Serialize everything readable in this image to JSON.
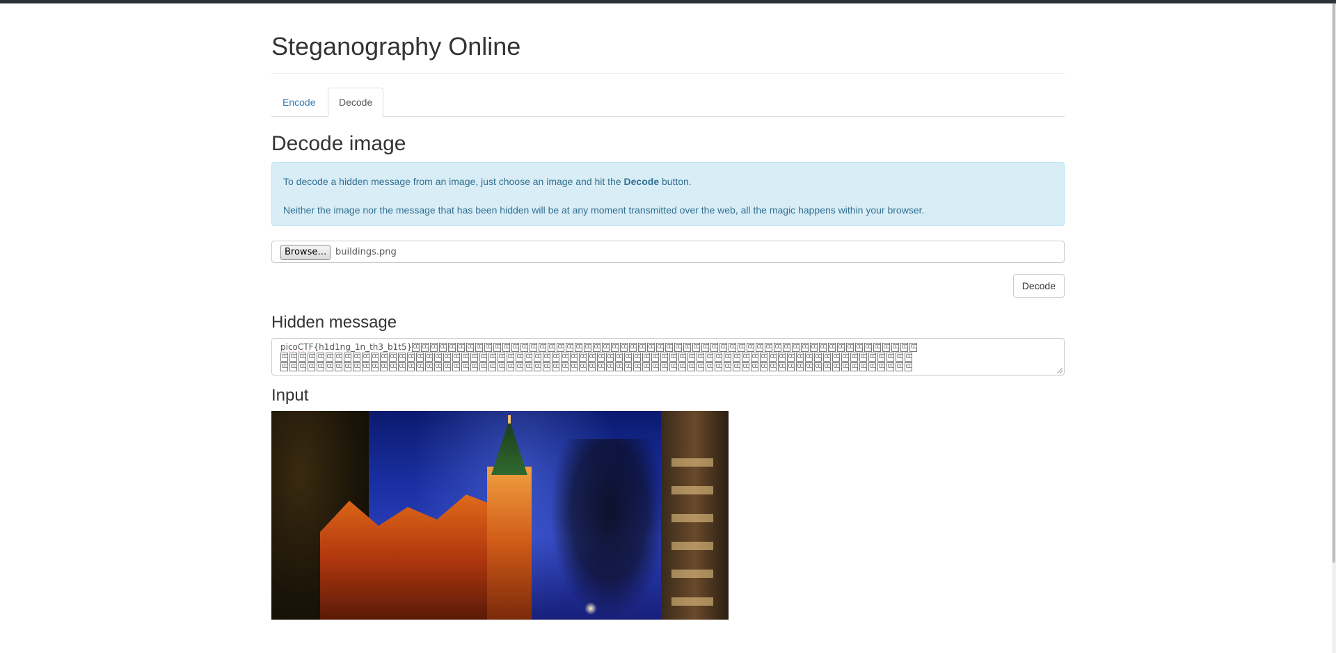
{
  "page": {
    "title": "Steganography Online"
  },
  "tabs": [
    {
      "label": "Encode",
      "active": false
    },
    {
      "label": "Decode",
      "active": true
    }
  ],
  "decode": {
    "title": "Decode image",
    "info_line1_prefix": "To decode a hidden message from an image, just choose an image and hit the ",
    "info_line1_bold": "Decode",
    "info_line1_suffix": " button.",
    "info_line2": "Neither the image nor the message that has been hidden will be at any moment transmitted over the web, all the magic happens within your browser.",
    "browse_label": "Browse…",
    "file_name": "buildings.png",
    "decode_button": "Decode"
  },
  "hidden_message": {
    "title": "Hidden message",
    "flag_word": "picoCTF",
    "flag_rest": "{h1d1ng_1n_th3_b1t5}",
    "glyph_description": "unprintable-character"
  },
  "input": {
    "title": "Input",
    "image_description": "church-at-night-photo"
  },
  "colors": {
    "link": "#337ab7",
    "alert_bg": "#d9edf7",
    "alert_text": "#31708f",
    "top_bar": "#2d3035"
  }
}
